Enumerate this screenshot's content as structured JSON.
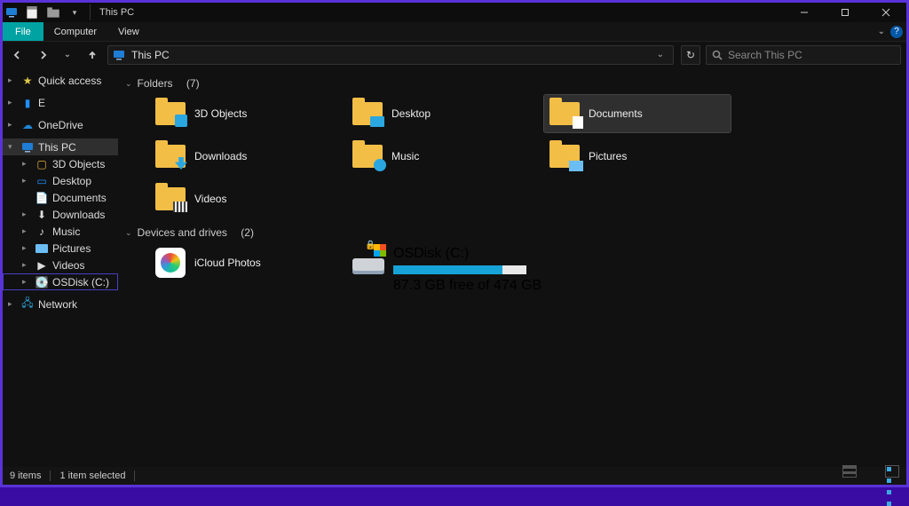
{
  "title": "This PC",
  "ribbon": {
    "file": "File",
    "tabs": [
      "Computer",
      "View"
    ]
  },
  "nav": {
    "address": "This PC",
    "search_placeholder": "Search This PC"
  },
  "sidebar": {
    "quick_access": "Quick access",
    "e_drive": "E",
    "onedrive": "OneDrive",
    "this_pc": "This PC",
    "children": {
      "tdobj": "3D Objects",
      "desktop": "Desktop",
      "documents": "Documents",
      "downloads": "Downloads",
      "music": "Music",
      "pictures": "Pictures",
      "videos": "Videos",
      "osdisk": "OSDisk (C:)"
    },
    "network": "Network"
  },
  "groups": {
    "folders": {
      "label": "Folders",
      "count": "(7)"
    },
    "drives": {
      "label": "Devices and drives",
      "count": "(2)"
    }
  },
  "folders": {
    "tdobj": "3D Objects",
    "desktop": "Desktop",
    "documents": "Documents",
    "downloads": "Downloads",
    "music": "Music",
    "pictures": "Pictures",
    "videos": "Videos"
  },
  "drives": {
    "icloud": "iCloud Photos",
    "osdisk": {
      "name": "OSDisk (C:)",
      "free_text": "87.3 GB free of 474 GB",
      "fill_pct": "82%"
    }
  },
  "status": {
    "items": "9 items",
    "selected": "1 item selected"
  }
}
